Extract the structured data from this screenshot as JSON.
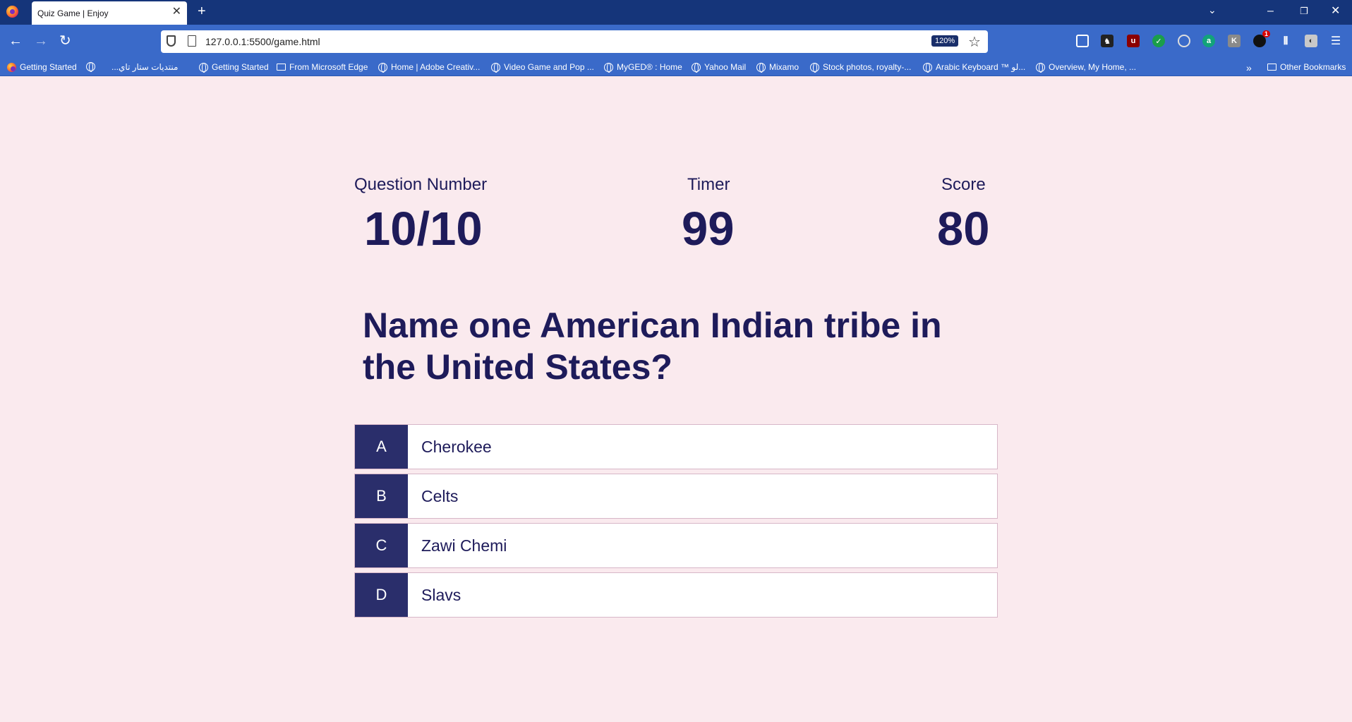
{
  "browser": {
    "tab_title": "Quiz Game | Enjoy",
    "url": "127.0.0.1:5500/game.html",
    "zoom": "120%",
    "bookmarks": [
      "Getting Started",
      "...منتديات ستار تاي",
      "Getting Started",
      "From Microsoft Edge",
      "Home | Adobe Creativ...",
      "Video Game and Pop ...",
      "MyGED® : Home",
      "Yahoo Mail",
      "Mixamo",
      "Stock photos, royalty-...",
      "Arabic Keyboard ™ لو...",
      "Overview, My Home, ..."
    ],
    "other_bookmarks": "Other Bookmarks",
    "extension_badge": "1"
  },
  "hud": {
    "question_label": "Question Number",
    "question_value": "10/10",
    "timer_label": "Timer",
    "timer_value": "99",
    "score_label": "Score",
    "score_value": "80"
  },
  "question": "Name one American Indian tribe in the United States?",
  "choices": [
    {
      "prefix": "A",
      "text": "Cherokee"
    },
    {
      "prefix": "B",
      "text": "Celts"
    },
    {
      "prefix": "C",
      "text": "Zawi Chemi"
    },
    {
      "prefix": "D",
      "text": "Slavs"
    }
  ],
  "colors": {
    "page_background": "#faeaee",
    "text": "#1e1b5a",
    "choice_prefix_bg": "#2a2e6b"
  }
}
